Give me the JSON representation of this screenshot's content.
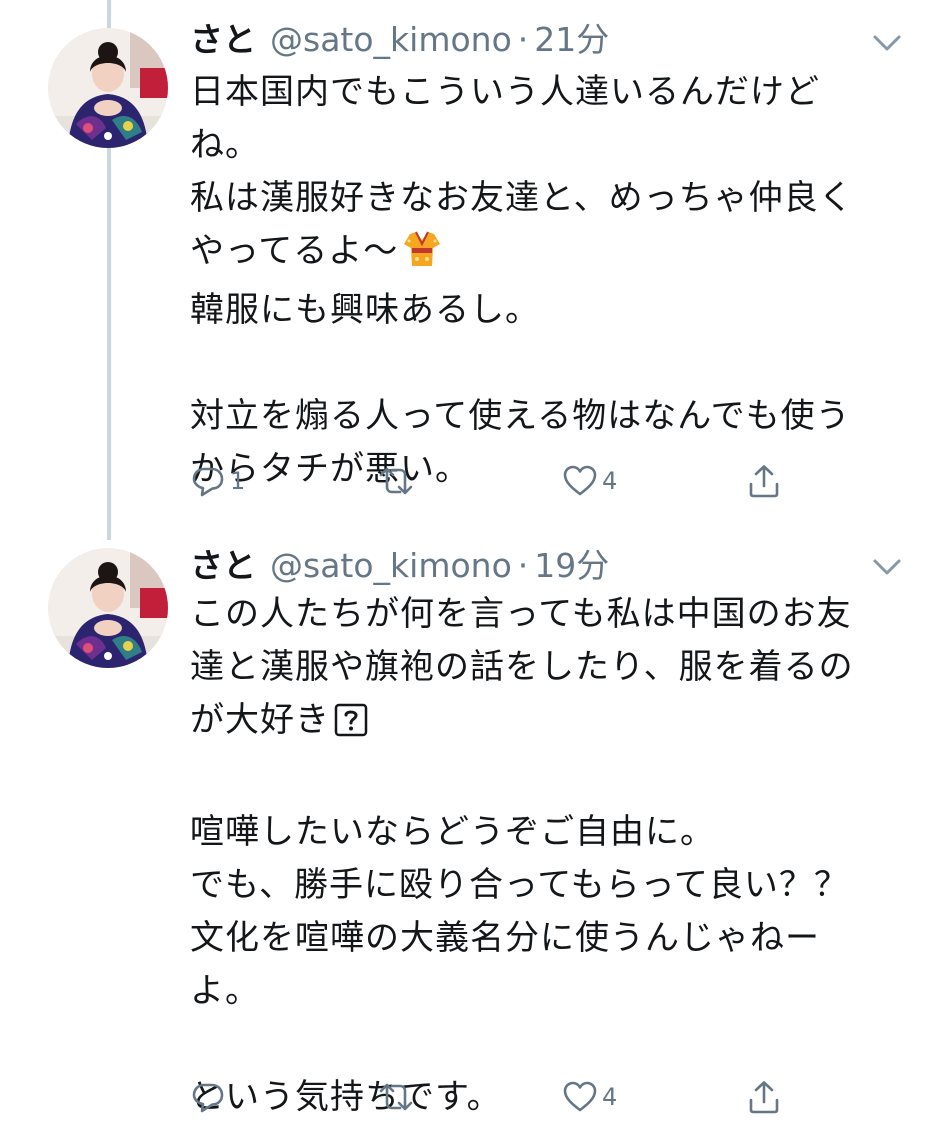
{
  "colors": {
    "text": "#14171a",
    "secondary": "#657786",
    "thread_line": "#ccd6dd",
    "background": "#ffffff"
  },
  "tweets": [
    {
      "name": "さと",
      "handle": "@sato_kimono",
      "separator": "·",
      "time": "21分",
      "text_lines": [
        "日本国内でもこういう人達いるんだけど",
        "ね。",
        "私は漢服好きなお友達と、めっちゃ仲良く",
        "やってるよ～",
        "韓服にも興味あるし。",
        "",
        "対立を煽る人って使える物はなんでも使う",
        "からタチが悪い。"
      ],
      "reply_count": "1",
      "retweet_count": "",
      "like_count": "4",
      "icons": [
        "reply-icon",
        "retweet-icon",
        "like-icon",
        "share-icon"
      ]
    },
    {
      "name": "さと",
      "handle": "@sato_kimono",
      "separator": "·",
      "time": "19分",
      "text_lines": [
        "この人たちが何を言っても私は中国のお友",
        "達と漢服や旗袍の話をしたり、服を着るの",
        "が大好き",
        "",
        "喧嘩したいならどうぞご自由に。",
        "でも、勝手に殴り合ってもらって良い？？",
        "文化を喧嘩の大義名分に使うんじゃねー",
        "よ。",
        "",
        "という気持ちです。"
      ],
      "reply_count": "",
      "retweet_count": "",
      "like_count": "4",
      "icons": [
        "reply-icon",
        "retweet-icon",
        "like-icon",
        "share-icon"
      ]
    }
  ]
}
